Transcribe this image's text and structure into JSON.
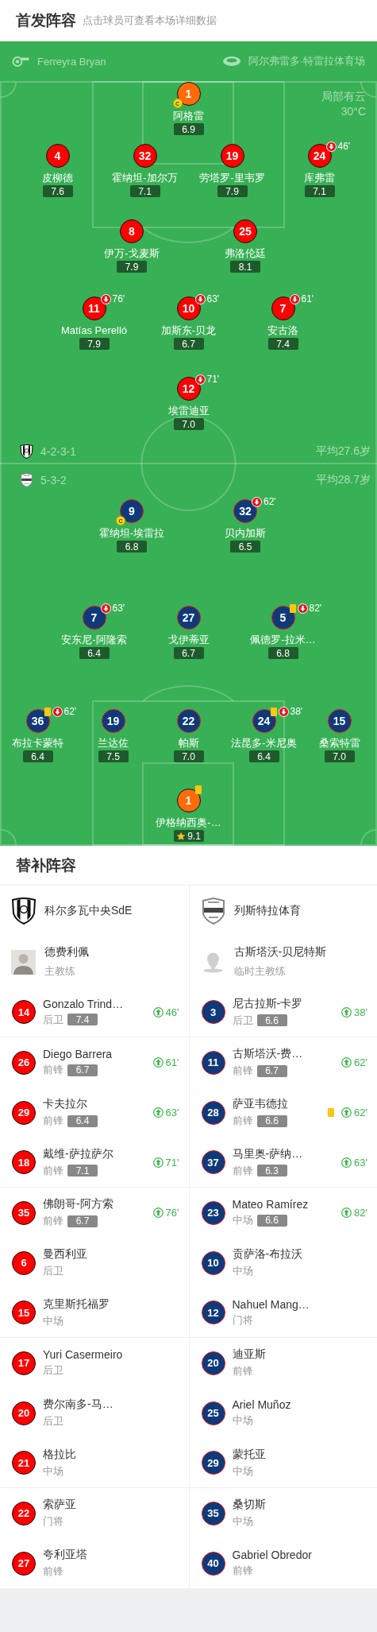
{
  "header": {
    "title": "首发阵容",
    "hint": "点击球员可查看本场详细数据"
  },
  "match_info": {
    "referee": "Ferreyra Bryan",
    "venue": "阿尔弗雷多·特雷拉体育场",
    "weather": "局部有云",
    "temperature": "30°C"
  },
  "teams": [
    {
      "kind": "home",
      "formation": "4-2-3-1",
      "average_age": "平均27.6岁",
      "lines": [
        [
          {
            "number": "1",
            "name": "阿格雷",
            "rating": "6.9",
            "kind": "goalkeeper",
            "captain": true,
            "captain_badge": "C",
            "yellow_card": false,
            "best": false
          }
        ],
        [
          {
            "number": "4",
            "name": "皮柳德",
            "rating": "7.6",
            "kind": "outfield",
            "captain": false,
            "yellow_card": false,
            "best": false
          },
          {
            "number": "32",
            "name": "霍纳坦-加尔万",
            "rating": "7.1",
            "kind": "outfield",
            "captain": false,
            "yellow_card": false,
            "best": false
          },
          {
            "number": "19",
            "name": "劳塔罗-里韦罗",
            "rating": "7.9",
            "kind": "outfield",
            "captain": false,
            "yellow_card": false,
            "best": false
          },
          {
            "number": "24",
            "name": "库弗雷",
            "rating": "7.1",
            "kind": "outfield",
            "captain": false,
            "yellow_card": false,
            "best": false,
            "sub_off": "46'"
          }
        ],
        [
          {
            "number": "8",
            "name": "伊万-戈麦斯",
            "rating": "7.9",
            "kind": "outfield",
            "captain": false,
            "yellow_card": false,
            "best": false
          },
          {
            "number": "25",
            "name": "弗洛伦廷",
            "rating": "8.1",
            "kind": "outfield",
            "captain": false,
            "yellow_card": false,
            "best": false
          }
        ],
        [
          {
            "number": "11",
            "name": "Matías Perelló",
            "rating": "7.9",
            "kind": "outfield",
            "captain": false,
            "yellow_card": false,
            "best": false,
            "sub_off": "76'"
          },
          {
            "number": "10",
            "name": "加斯东-贝龙",
            "rating": "6.7",
            "kind": "outfield",
            "captain": false,
            "yellow_card": false,
            "best": false,
            "sub_off": "63'"
          },
          {
            "number": "7",
            "name": "安古洛",
            "rating": "7.4",
            "kind": "outfield",
            "captain": false,
            "yellow_card": false,
            "best": false,
            "sub_off": "61'"
          }
        ],
        [
          {
            "number": "12",
            "name": "埃雷迪亚",
            "rating": "7.0",
            "kind": "outfield",
            "captain": false,
            "yellow_card": false,
            "best": false,
            "sub_off": "71'"
          }
        ]
      ]
    },
    {
      "kind": "away",
      "formation": "5-3-2",
      "average_age": "平均28.7岁",
      "lines": [
        [
          {
            "number": "9",
            "name": "霍纳坦-埃雷拉",
            "rating": "6.8",
            "kind": "outfield",
            "captain": true,
            "captain_badge": "C",
            "yellow_card": false,
            "best": false
          },
          {
            "number": "32",
            "name": "贝内加斯",
            "rating": "6.5",
            "kind": "outfield",
            "captain": false,
            "yellow_card": false,
            "best": false,
            "sub_off": "62'"
          }
        ],
        [
          {
            "number": "7",
            "name": "安东尼-阿隆索",
            "rating": "6.4",
            "kind": "outfield",
            "captain": false,
            "yellow_card": false,
            "best": false,
            "sub_off": "63'"
          },
          {
            "number": "27",
            "name": "戈伊蒂亚",
            "rating": "6.7",
            "kind": "outfield",
            "captain": false,
            "yellow_card": false,
            "best": false
          },
          {
            "number": "5",
            "name": "佩德罗-拉米…",
            "rating": "6.8",
            "kind": "outfield",
            "captain": false,
            "yellow_card": true,
            "best": false,
            "sub_off": "82'"
          }
        ],
        [
          {
            "number": "36",
            "name": "布拉卡蒙特",
            "rating": "6.4",
            "kind": "outfield",
            "captain": false,
            "yellow_card": true,
            "best": false,
            "sub_off": "62'"
          },
          {
            "number": "19",
            "name": "兰达佐",
            "rating": "7.5",
            "kind": "outfield",
            "captain": false,
            "yellow_card": false,
            "best": false
          },
          {
            "number": "22",
            "name": "帕斯",
            "rating": "7.0",
            "kind": "outfield",
            "captain": false,
            "yellow_card": false,
            "best": false
          },
          {
            "number": "24",
            "name": "法昆多-米尼奥",
            "rating": "6.4",
            "kind": "outfield",
            "captain": false,
            "yellow_card": true,
            "best": false,
            "sub_off": "38'"
          },
          {
            "number": "15",
            "name": "桑索特雷",
            "rating": "7.0",
            "kind": "outfield",
            "captain": false,
            "yellow_card": false,
            "best": false
          }
        ],
        [
          {
            "number": "1",
            "name": "伊格纳西奥-…",
            "rating": "9.1",
            "kind": "goalkeeper",
            "captain": false,
            "yellow_card": true,
            "best": true
          }
        ]
      ]
    }
  ],
  "substitutes": {
    "title": "替补阵容",
    "teams": [
      {
        "kind": "home",
        "name": "科尔多瓦中央SdE",
        "coach": {
          "name": "德费利佩",
          "role": "主教练"
        },
        "players": [
          {
            "number": "14",
            "name": "Gonzalo Trind…",
            "position": "后卫",
            "rating": "7.4",
            "sub_in": "46'",
            "yellow_card": false
          },
          {
            "number": "26",
            "name": "Diego Barrera",
            "position": "前锋",
            "rating": "6.7",
            "sub_in": "61'",
            "yellow_card": false
          },
          {
            "number": "29",
            "name": "卡夫拉尔",
            "position": "前锋",
            "rating": "6.4",
            "sub_in": "63'",
            "yellow_card": false
          },
          {
            "number": "18",
            "name": "戴维-萨拉萨尔",
            "position": "前锋",
            "rating": "7.1",
            "sub_in": "71'",
            "yellow_card": false
          },
          {
            "number": "35",
            "name": "佛朗哥-阿方索",
            "position": "前锋",
            "rating": "6.7",
            "sub_in": "76'",
            "yellow_card": false
          },
          {
            "number": "6",
            "name": "曼西利亚",
            "position": "后卫",
            "yellow_card": false
          },
          {
            "number": "15",
            "name": "克里斯托福罗",
            "position": "中场",
            "yellow_card": false
          },
          {
            "number": "17",
            "name": "Yuri Casermeiro",
            "position": "后卫",
            "yellow_card": false
          },
          {
            "number": "20",
            "name": "费尔南多-马…",
            "position": "后卫",
            "yellow_card": false
          },
          {
            "number": "21",
            "name": "格拉比",
            "position": "中场",
            "yellow_card": false
          },
          {
            "number": "22",
            "name": "索萨亚",
            "position": "门将",
            "yellow_card": false
          },
          {
            "number": "27",
            "name": "夸利亚塔",
            "position": "前锋",
            "yellow_card": false
          }
        ]
      },
      {
        "kind": "away",
        "name": "列斯特拉体育",
        "coach": {
          "name": "古斯塔沃-贝尼特斯",
          "role": "临时主教练"
        },
        "players": [
          {
            "number": "3",
            "name": "尼古拉斯-卡罗",
            "position": "后卫",
            "rating": "6.6",
            "sub_in": "38'",
            "yellow_card": false
          },
          {
            "number": "11",
            "name": "古斯塔沃-费…",
            "position": "前锋",
            "rating": "6.7",
            "sub_in": "62'",
            "yellow_card": false
          },
          {
            "number": "28",
            "name": "萨亚韦德拉",
            "position": "前锋",
            "rating": "6.6",
            "sub_in": "62'",
            "yellow_card": true
          },
          {
            "number": "37",
            "name": "马里奥-萨纳…",
            "position": "前锋",
            "rating": "6.3",
            "sub_in": "63'",
            "yellow_card": false
          },
          {
            "number": "23",
            "name": "Mateo Ramírez",
            "position": "中场",
            "rating": "6.6",
            "sub_in": "82'",
            "yellow_card": false
          },
          {
            "number": "10",
            "name": "贡萨洛-布拉沃",
            "position": "中场",
            "yellow_card": false
          },
          {
            "number": "12",
            "name": "Nahuel Mang…",
            "position": "门将",
            "yellow_card": false
          },
          {
            "number": "20",
            "name": "迪亚斯",
            "position": "前锋",
            "yellow_card": false
          },
          {
            "number": "25",
            "name": "Ariel Muñoz",
            "position": "中场",
            "yellow_card": false
          },
          {
            "number": "29",
            "name": "蒙托亚",
            "position": "中场",
            "yellow_card": false
          },
          {
            "number": "35",
            "name": "桑切斯",
            "position": "中场",
            "yellow_card": false
          },
          {
            "number": "40",
            "name": "Gabriel Obredor",
            "position": "前锋",
            "yellow_card": false
          }
        ]
      }
    ]
  }
}
